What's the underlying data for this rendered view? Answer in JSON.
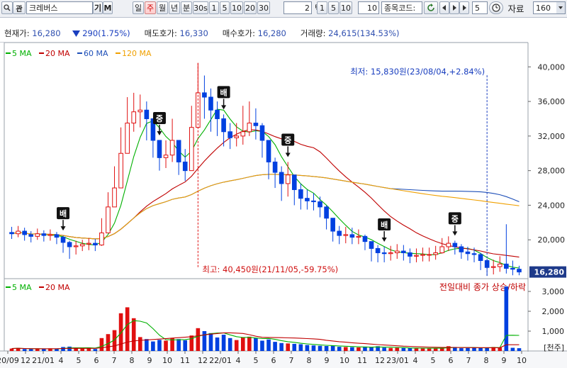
{
  "toolbar": {
    "stock_name": "크레버스",
    "code_btn": "기",
    "m_btn": "M",
    "periods": [
      "일",
      "주",
      "월",
      "년",
      "분",
      "30s",
      "1",
      "5",
      "10",
      "20",
      "30"
    ],
    "active_period": "주",
    "tick_count": "2",
    "tick_label": "틱",
    "tick_options": [
      "1",
      "5",
      "10"
    ],
    "tick_value": "10",
    "code_search_label": "종목코드:",
    "count_value": "5",
    "data_label": "자료",
    "data_count": "160"
  },
  "info": {
    "current_label": "현재가:",
    "current_value": "16,280",
    "change_value": "290(1.75%)",
    "ask_label": "매도호가:",
    "ask_value": "16,330",
    "bid_label": "매수호가:",
    "bid_value": "16,280",
    "volume_label": "거래량:",
    "volume_value": "24,615(134.53%)"
  },
  "chart_data": [
    {
      "type": "candlestick",
      "legend": [
        {
          "name": "5 MA",
          "color": "#00b000"
        },
        {
          "name": "20 MA",
          "color": "#c00000"
        },
        {
          "name": "60 MA",
          "color": "#1e4fb8"
        },
        {
          "name": "120 MA",
          "color": "#f0a000"
        }
      ],
      "y_ticks": [
        "40,000",
        "36,000",
        "32,000",
        "28,000",
        "24,000",
        "20,000"
      ],
      "ylim": [
        16000,
        41500
      ],
      "last_price": "16,280",
      "x_ticks": [
        "20/09",
        "12",
        "21/01",
        "4",
        "5",
        "6",
        "7",
        "8",
        "9",
        "10",
        "11",
        "12",
        "22/01",
        "4",
        "5",
        "6",
        "7",
        "8",
        "9",
        "10",
        "11",
        "12",
        "23/01",
        "4",
        "5",
        "6",
        "7",
        "8",
        "9",
        "10"
      ],
      "close": [
        20700,
        21000,
        20600,
        20400,
        20700,
        20500,
        20600,
        20300,
        19700,
        19200,
        19300,
        19500,
        19600,
        19400,
        20800,
        23800,
        26000,
        30000,
        33500,
        34800,
        35000,
        34000,
        31500,
        29500,
        29800,
        31500,
        29000,
        28000,
        33000,
        37000,
        36500,
        35000,
        34000,
        32500,
        31800,
        32000,
        32500,
        33500,
        33200,
        31500,
        29000,
        27800,
        26500,
        27500,
        25800,
        24800,
        24500,
        24400,
        23800,
        22500,
        21000,
        20500,
        20600,
        20300,
        20400,
        19800,
        19000,
        18500,
        18400,
        18500,
        18700,
        18500,
        18100,
        18200,
        18300,
        18300,
        18500,
        19200,
        19600,
        19200,
        18600,
        18400,
        18300,
        17600,
        16800,
        16900,
        17200,
        16700,
        16600,
        16280
      ],
      "high": [
        21500,
        21600,
        21400,
        21000,
        21300,
        21100,
        21200,
        20900,
        20500,
        19900,
        19900,
        20000,
        20200,
        20100,
        22500,
        25500,
        28500,
        33000,
        36500,
        37000,
        36800,
        36000,
        34000,
        31500,
        31500,
        34000,
        31500,
        30500,
        35500,
        40450,
        39000,
        37500,
        36000,
        34500,
        33500,
        33500,
        35500,
        36000,
        35200,
        33500,
        31000,
        29500,
        28500,
        29000,
        27500,
        26500,
        25800,
        25400,
        25000,
        24000,
        22500,
        21600,
        21500,
        21400,
        21200,
        20600,
        19800,
        19400,
        19200,
        19300,
        19500,
        19400,
        19000,
        19000,
        19100,
        19100,
        19300,
        20200,
        20400,
        19900,
        19500,
        19200,
        19100,
        18500,
        17800,
        17700,
        18100,
        21800,
        17600,
        17000
      ],
      "low": [
        20100,
        20300,
        19900,
        19700,
        20000,
        19800,
        19900,
        19500,
        18500,
        17800,
        18300,
        18700,
        18800,
        18700,
        19300,
        21000,
        24000,
        27000,
        30000,
        32500,
        33000,
        31500,
        29500,
        28000,
        28300,
        29000,
        27500,
        26800,
        28500,
        33500,
        34000,
        32500,
        32000,
        30800,
        30500,
        30800,
        31000,
        32000,
        31600,
        29500,
        27000,
        26000,
        24500,
        25000,
        24000,
        23500,
        23500,
        23400,
        22600,
        21200,
        19800,
        19500,
        19600,
        19500,
        19500,
        18800,
        17500,
        17400,
        17400,
        17600,
        17800,
        17600,
        17300,
        17400,
        17500,
        17500,
        17700,
        18400,
        18700,
        18300,
        17800,
        17600,
        17400,
        16500,
        15830,
        16000,
        16300,
        16100,
        15900,
        15900
      ],
      "annotations": [
        {
          "text": "배",
          "idx": 8
        },
        {
          "text": "중",
          "idx": 23
        },
        {
          "text": "배",
          "idx": 33
        },
        {
          "text": "중",
          "idx": 43
        },
        {
          "text": "배",
          "idx": 58
        },
        {
          "text": "중",
          "idx": 69
        }
      ],
      "label_low": "최저: 15,830원(23/08/04,+2.84%)",
      "label_high": "최고: 40,450원(21/11/05,-59.75%)"
    },
    {
      "type": "bar",
      "title": "전일대비 종가 상승/하락",
      "legend": [
        {
          "name": "5 MA",
          "color": "#00b000"
        },
        {
          "name": "20 MA",
          "color": "#c00000"
        }
      ],
      "y_ticks": [
        "3,000",
        "2,000",
        "1,000"
      ],
      "ylim": [
        0,
        3500
      ],
      "unit_label": "[천주]",
      "volume": [
        120,
        150,
        100,
        90,
        110,
        100,
        130,
        110,
        200,
        220,
        150,
        120,
        140,
        100,
        650,
        850,
        1050,
        1900,
        2200,
        1650,
        700,
        600,
        480,
        560,
        520,
        650,
        600,
        540,
        780,
        1150,
        1000,
        900,
        680,
        820,
        650,
        550,
        700,
        720,
        640,
        520,
        580,
        460,
        400,
        380,
        360,
        340,
        300,
        280,
        260,
        250,
        270,
        210,
        200,
        190,
        180,
        220,
        180,
        240,
        170,
        150,
        160,
        150,
        140,
        130,
        130,
        140,
        150,
        140,
        240,
        200,
        140,
        150,
        170,
        150,
        180,
        200,
        170,
        3250,
        160,
        140
      ]
    }
  ]
}
